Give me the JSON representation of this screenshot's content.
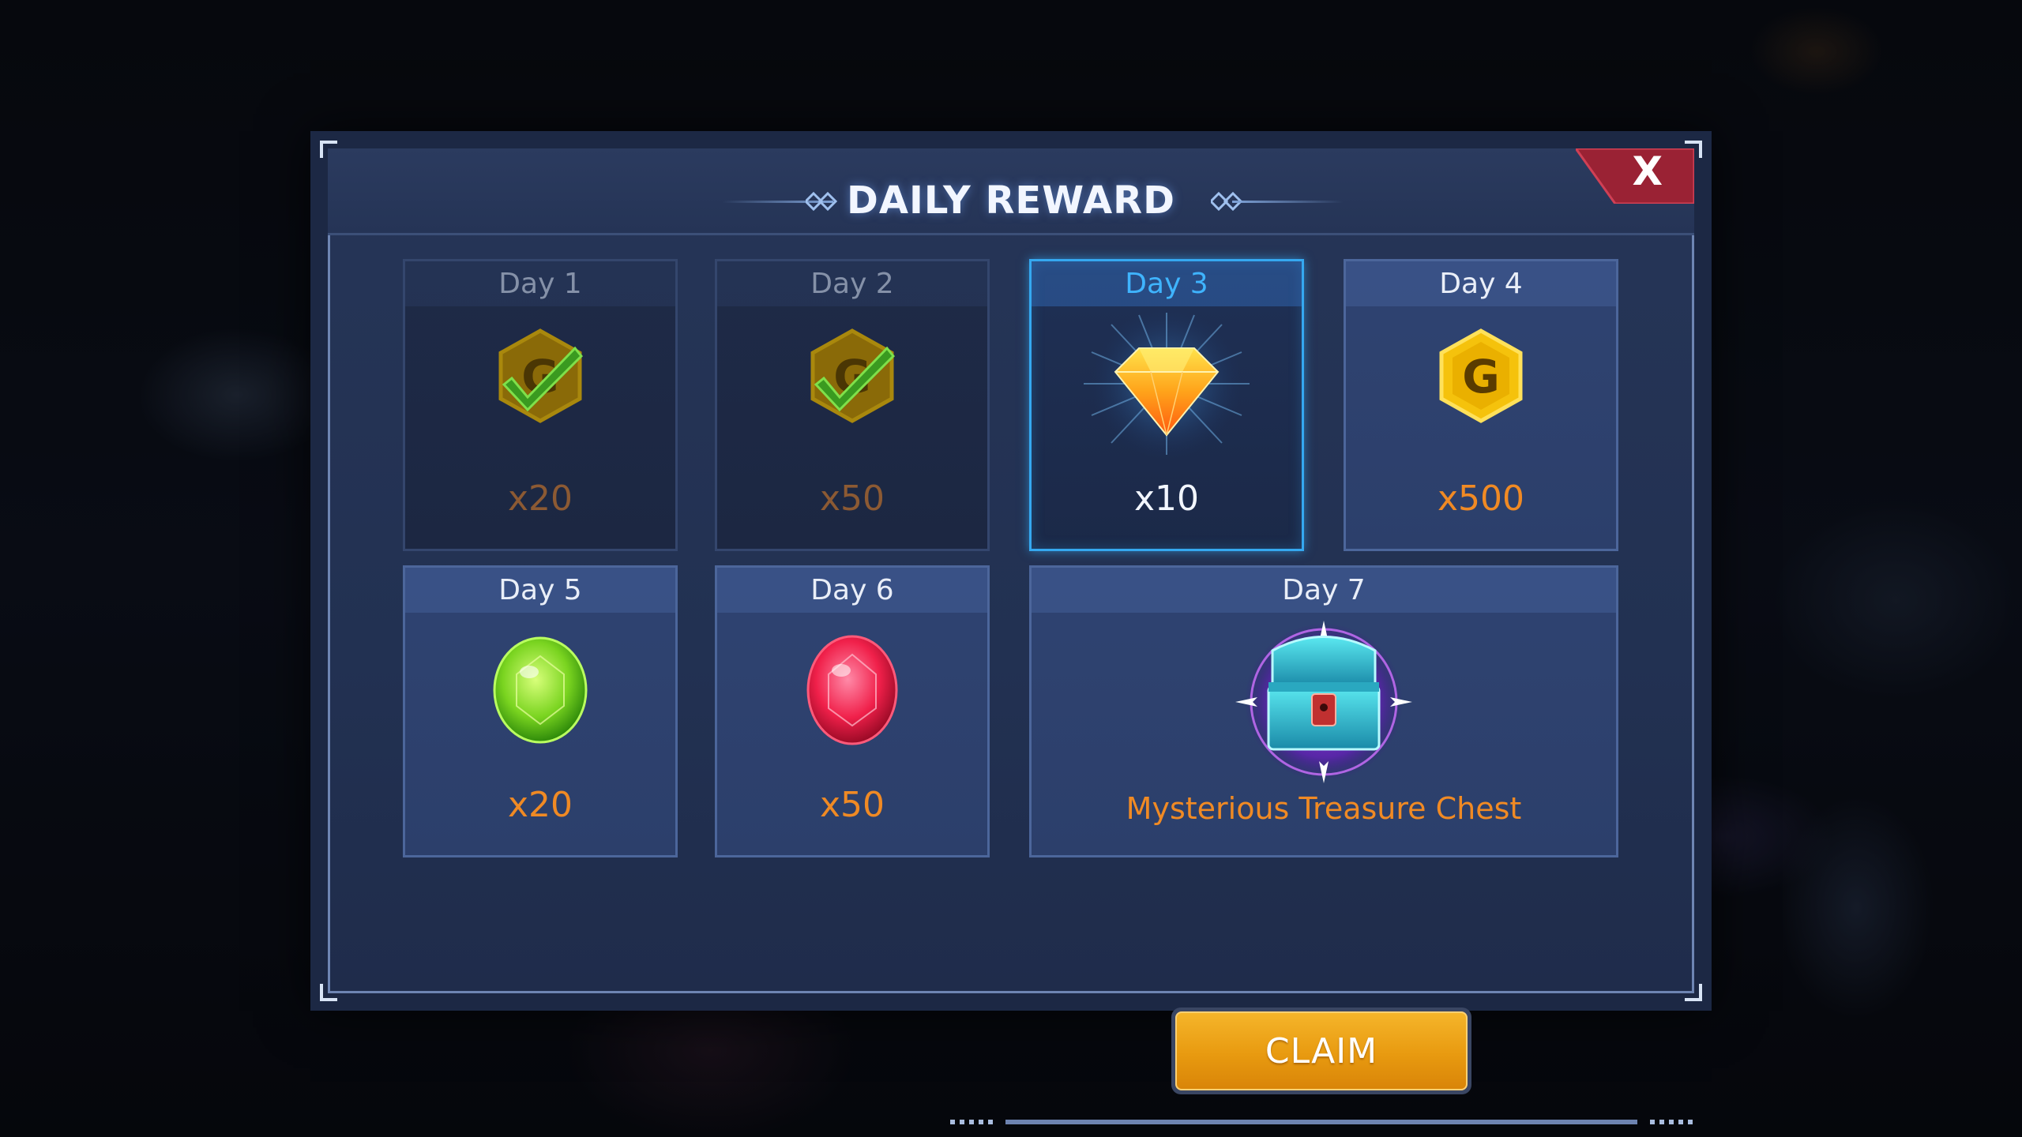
{
  "dialog": {
    "title": "DAILY REWARD",
    "close_label": "X"
  },
  "rewards": [
    {
      "day": "Day 1",
      "amount": "x20",
      "item": "gold-coin",
      "state": "claimed"
    },
    {
      "day": "Day 2",
      "amount": "x50",
      "item": "gold-coin",
      "state": "claimed"
    },
    {
      "day": "Day 3",
      "amount": "x10",
      "item": "orange-diamond",
      "state": "current"
    },
    {
      "day": "Day 4",
      "amount": "x500",
      "item": "gold-coin",
      "state": "locked"
    },
    {
      "day": "Day 5",
      "amount": "x20",
      "item": "green-gem",
      "state": "locked"
    },
    {
      "day": "Day 6",
      "amount": "x50",
      "item": "red-gem",
      "state": "locked"
    },
    {
      "day": "Day 7",
      "amount": "Mysterious Treasure Chest",
      "item": "treasure-chest",
      "state": "locked"
    }
  ],
  "coin_letter": "G",
  "claim_button": {
    "label": "CLAIM"
  },
  "colors": {
    "accent_orange": "#f08a24",
    "current_blue": "#35a8f0",
    "claim_gold": "#f5b52a",
    "close_red": "#b8283a"
  }
}
